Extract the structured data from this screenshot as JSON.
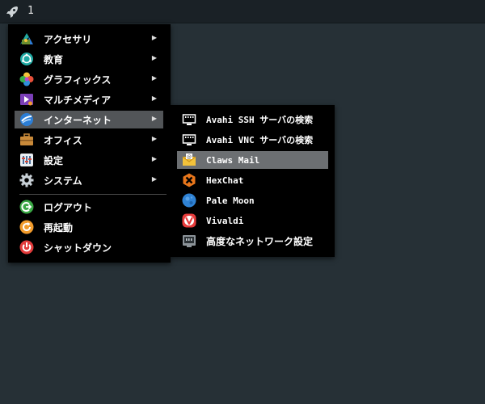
{
  "panel": {
    "workspace_number": "1"
  },
  "menu": {
    "items": [
      {
        "label": "アクセサリ",
        "icon": "accessories-icon",
        "has_submenu": true
      },
      {
        "label": "教育",
        "icon": "education-icon",
        "has_submenu": true
      },
      {
        "label": "グラフィックス",
        "icon": "graphics-icon",
        "has_submenu": true
      },
      {
        "label": "マルチメディア",
        "icon": "multimedia-icon",
        "has_submenu": true
      },
      {
        "label": "インターネット",
        "icon": "internet-icon",
        "has_submenu": true,
        "active": true
      },
      {
        "label": "オフィス",
        "icon": "office-icon",
        "has_submenu": true
      },
      {
        "label": "設定",
        "icon": "settings-icon",
        "has_submenu": true
      },
      {
        "label": "システム",
        "icon": "system-icon",
        "has_submenu": true
      }
    ],
    "session": [
      {
        "label": "ログアウト",
        "icon": "logout-icon"
      },
      {
        "label": "再起動",
        "icon": "restart-icon"
      },
      {
        "label": "シャットダウン",
        "icon": "shutdown-icon"
      }
    ],
    "submenu_arrow": "▶"
  },
  "submenu": {
    "items": [
      {
        "label": "Avahi SSH サーバの検索",
        "icon": "network-monitor-icon"
      },
      {
        "label": "Avahi VNC サーバの検索",
        "icon": "network-monitor-icon"
      },
      {
        "label": "Claws Mail",
        "icon": "claws-mail-icon",
        "active": true
      },
      {
        "label": "HexChat",
        "icon": "hexchat-icon"
      },
      {
        "label": "Pale Moon",
        "icon": "pale-moon-icon"
      },
      {
        "label": "Vivaldi",
        "icon": "vivaldi-icon"
      },
      {
        "label": "高度なネットワーク設定",
        "icon": "network-settings-icon"
      }
    ]
  },
  "colors": {
    "desktop": "#263036",
    "menu_bg": "#000000",
    "active_item": "#525558",
    "active_subitem": "#6c6f72"
  }
}
